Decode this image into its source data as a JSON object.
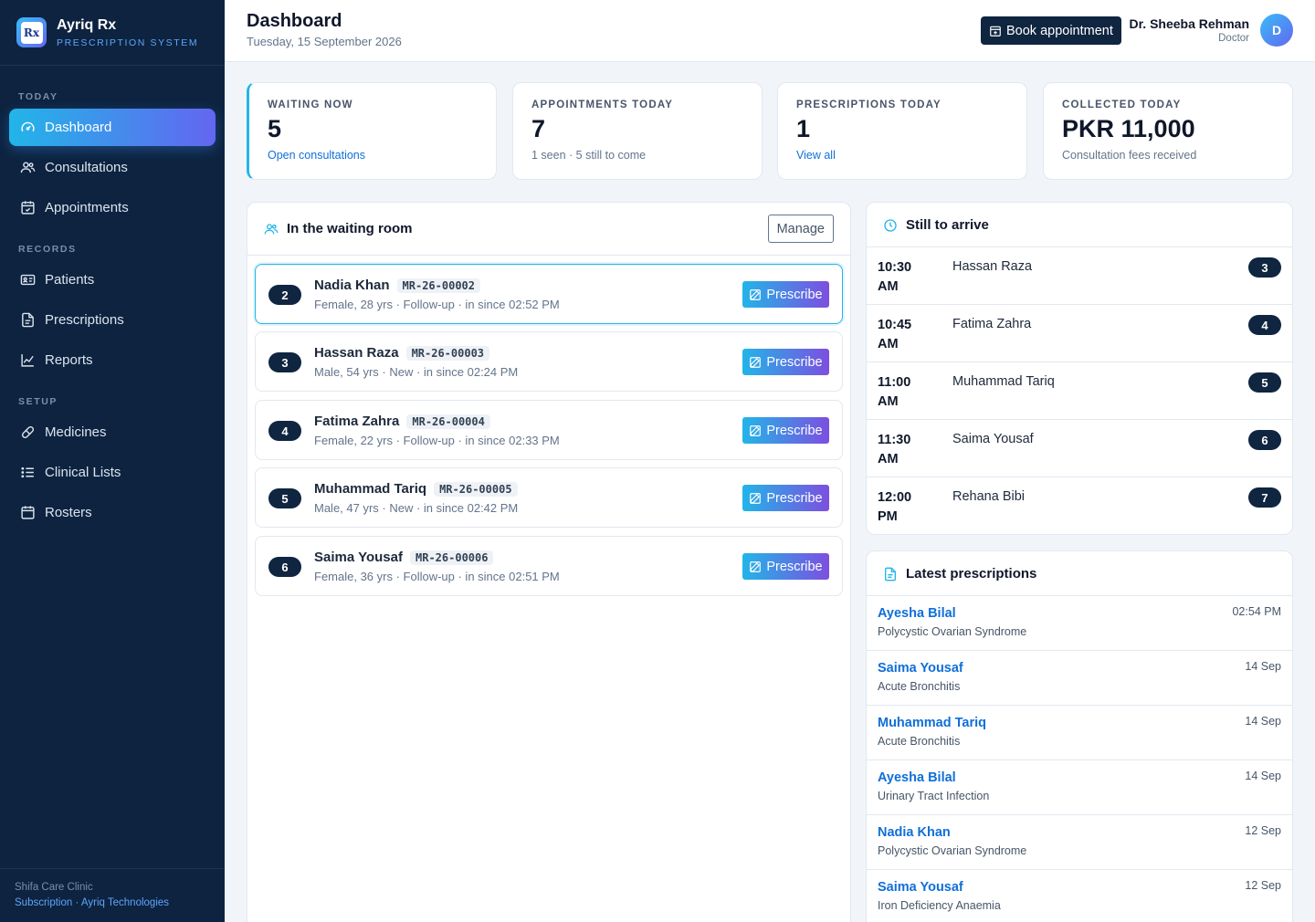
{
  "brand": {
    "name": "Ayriq Rx",
    "subtitle": "PRESCRIPTION SYSTEM",
    "logo_text": "Rx"
  },
  "nav": {
    "sections": [
      "TODAY",
      "RECORDS",
      "SETUP"
    ],
    "items": [
      {
        "label": "Dashboard",
        "icon": "gauge-icon",
        "active": true
      },
      {
        "label": "Consultations",
        "icon": "users-icon"
      },
      {
        "label": "Appointments",
        "icon": "calendar-check-icon"
      },
      {
        "label": "Patients",
        "icon": "id-card-icon"
      },
      {
        "label": "Prescriptions",
        "icon": "file-text-icon"
      },
      {
        "label": "Reports",
        "icon": "line-chart-icon"
      },
      {
        "label": "Medicines",
        "icon": "pill-icon"
      },
      {
        "label": "Clinical Lists",
        "icon": "list-icon"
      },
      {
        "label": "Rosters",
        "icon": "calendar-icon"
      }
    ]
  },
  "footer": {
    "clinic": "Shifa Care Clinic",
    "subscription": "Subscription",
    "separator": "·",
    "company": "Ayriq Technologies"
  },
  "header": {
    "title": "Dashboard",
    "date": "Tuesday, 15 September 2026",
    "book_label": "Book appointment",
    "user_name": "Dr. Sheeba Rehman",
    "user_role": "Doctor",
    "avatar_initial": "D"
  },
  "stats": [
    {
      "label": "WAITING NOW",
      "value": "5",
      "sub": "Open consultations",
      "sub_is_link": true
    },
    {
      "label": "APPOINTMENTS TODAY",
      "value": "7",
      "sub": "1 seen · 5 still to come",
      "sub_is_link": false
    },
    {
      "label": "PRESCRIPTIONS TODAY",
      "value": "1",
      "sub": "View all",
      "sub_is_link": true
    },
    {
      "label": "COLLECTED TODAY",
      "value": "PKR 11,000",
      "sub": "Consultation fees received",
      "sub_is_link": false
    }
  ],
  "waiting_room": {
    "title": "In the waiting room",
    "manage_label": "Manage",
    "prescribe_label": "Prescribe",
    "patients": [
      {
        "queue": "2",
        "name": "Nadia Khan",
        "mr": "MR-26-00002",
        "meta": "Female, 28 yrs · Follow-up · in since 02:52 PM"
      },
      {
        "queue": "3",
        "name": "Hassan Raza",
        "mr": "MR-26-00003",
        "meta": "Male, 54 yrs · New · in since 02:24 PM"
      },
      {
        "queue": "4",
        "name": "Fatima Zahra",
        "mr": "MR-26-00004",
        "meta": "Female, 22 yrs · Follow-up · in since 02:33 PM"
      },
      {
        "queue": "5",
        "name": "Muhammad Tariq",
        "mr": "MR-26-00005",
        "meta": "Male, 47 yrs · New · in since 02:42 PM"
      },
      {
        "queue": "6",
        "name": "Saima Yousaf",
        "mr": "MR-26-00006",
        "meta": "Female, 36 yrs · Follow-up · in since 02:51 PM"
      }
    ]
  },
  "arrivals": {
    "title": "Still to arrive",
    "items": [
      {
        "time": "10:30 AM",
        "name": "Hassan Raza",
        "queue": "3"
      },
      {
        "time": "10:45 AM",
        "name": "Fatima Zahra",
        "queue": "4"
      },
      {
        "time": "11:00 AM",
        "name": "Muhammad Tariq",
        "queue": "5"
      },
      {
        "time": "11:30 AM",
        "name": "Saima Yousaf",
        "queue": "6"
      },
      {
        "time": "12:00 PM",
        "name": "Rehana Bibi",
        "queue": "7"
      }
    ]
  },
  "prescriptions": {
    "title": "Latest prescriptions",
    "items": [
      {
        "name": "Ayesha Bilal",
        "diagnosis": "Polycystic Ovarian Syndrome",
        "date": "02:54 PM"
      },
      {
        "name": "Saima Yousaf",
        "diagnosis": "Acute Bronchitis",
        "date": "14 Sep"
      },
      {
        "name": "Muhammad Tariq",
        "diagnosis": "Acute Bronchitis",
        "date": "14 Sep"
      },
      {
        "name": "Ayesha Bilal",
        "diagnosis": "Urinary Tract Infection",
        "date": "14 Sep"
      },
      {
        "name": "Nadia Khan",
        "diagnosis": "Polycystic Ovarian Syndrome",
        "date": "12 Sep"
      },
      {
        "name": "Saima Yousaf",
        "diagnosis": "Iron Deficiency Anaemia",
        "date": "12 Sep"
      }
    ]
  },
  "colors": {
    "sidebar": "#0d2340",
    "accent_start": "#22b5e8",
    "accent_end": "#6366f1",
    "link": "#0f6fd9",
    "badge": "#0f2540"
  }
}
